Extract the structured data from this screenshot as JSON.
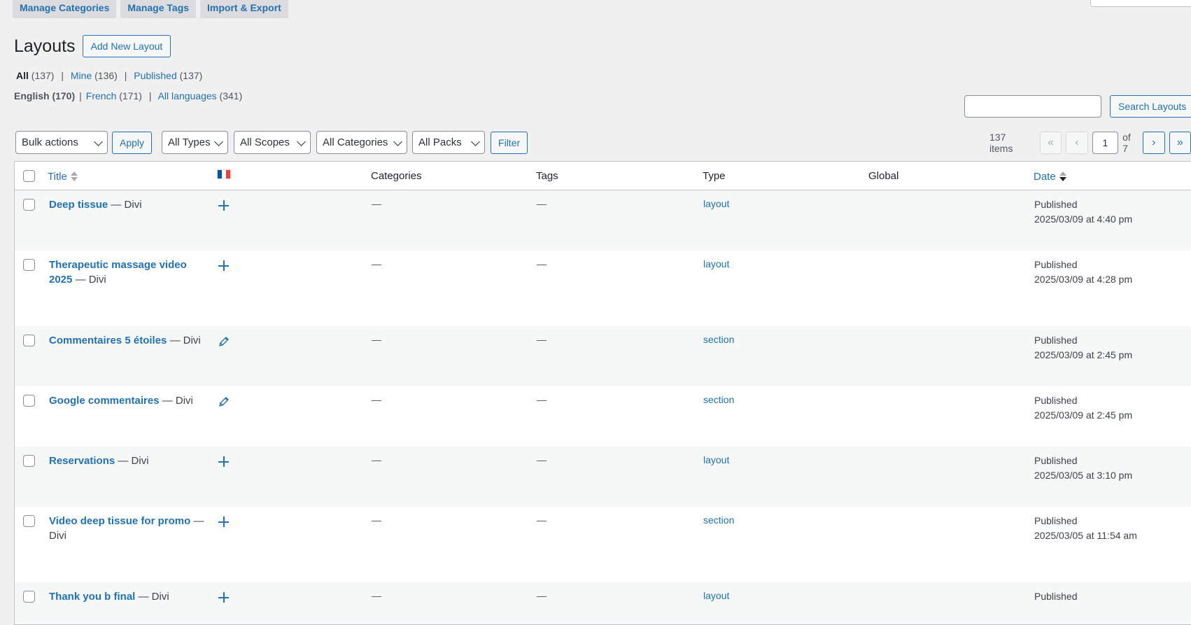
{
  "top_tabs": [
    "Manage Categories",
    "Manage Tags",
    "Import & Export"
  ],
  "page": {
    "title": "Layouts",
    "add_new_label": "Add New Layout"
  },
  "views": {
    "all_label": "All",
    "all_count": "(137)",
    "mine_label": "Mine",
    "mine_count": "(136)",
    "published_label": "Published",
    "published_count": "(137)"
  },
  "languages": {
    "english": "English (170)",
    "french_label": "French",
    "french_count": "(171)",
    "all_label": "All languages",
    "all_count": "(341)"
  },
  "search": {
    "value": "",
    "button_label": "Search Layouts"
  },
  "tablenav": {
    "bulk_actions": "Bulk actions",
    "apply_label": "Apply",
    "filters": [
      "All Types",
      "All Scopes",
      "All Categories",
      "All Packs"
    ],
    "filter_label": "Filter"
  },
  "pagination": {
    "items_count": "137 items",
    "first": "«",
    "prev": "‹",
    "current_page": "1",
    "of_total": "of 7",
    "next": "›",
    "last": "»"
  },
  "table": {
    "columns": {
      "title": "Title",
      "categories": "Categories",
      "tags": "Tags",
      "type": "Type",
      "global": "Global",
      "date": "Date"
    },
    "language_flag": "french-flag",
    "rows": [
      {
        "title": "Deep tissue",
        "suffix": "— Divi",
        "lang_icon": "plus-icon",
        "categories": "—",
        "tags": "—",
        "type": "layout",
        "global": "",
        "status": "Published",
        "date": "2025/03/09 at 4:40 pm"
      },
      {
        "title": "Therapeutic massage video 2025",
        "suffix": "— Divi",
        "lang_icon": "plus-icon",
        "categories": "—",
        "tags": "—",
        "type": "layout",
        "global": "",
        "status": "Published",
        "date": "2025/03/09 at 4:28 pm"
      },
      {
        "title": "Commentaires 5 étoiles",
        "suffix": "— Divi",
        "lang_icon": "pencil-icon",
        "categories": "—",
        "tags": "—",
        "type": "section",
        "global": "",
        "status": "Published",
        "date": "2025/03/09 at 2:45 pm"
      },
      {
        "title": "Google commentaires",
        "suffix": "— Divi",
        "lang_icon": "pencil-icon",
        "categories": "—",
        "tags": "—",
        "type": "section",
        "global": "",
        "status": "Published",
        "date": "2025/03/09 at 2:45 pm"
      },
      {
        "title": "Reservations",
        "suffix": "— Divi",
        "lang_icon": "plus-icon",
        "categories": "—",
        "tags": "—",
        "type": "layout",
        "global": "",
        "status": "Published",
        "date": "2025/03/05 at 3:10 pm"
      },
      {
        "title": "Video deep tissue for promo",
        "suffix": "— Divi",
        "lang_icon": "plus-icon",
        "categories": "—",
        "tags": "—",
        "type": "section",
        "global": "",
        "status": "Published",
        "date": "2025/03/05 at 11:54 am"
      },
      {
        "title": "Thank you b final",
        "suffix": "— Divi",
        "lang_icon": "plus-icon",
        "categories": "—",
        "tags": "—",
        "type": "layout",
        "global": "",
        "status": "Published",
        "date": ""
      }
    ]
  },
  "colors": {
    "link": "#2271b1",
    "background": "#f0f0f1",
    "flag_blue": "#0055a4",
    "flag_white": "#ffffff",
    "flag_red": "#ef4135"
  }
}
